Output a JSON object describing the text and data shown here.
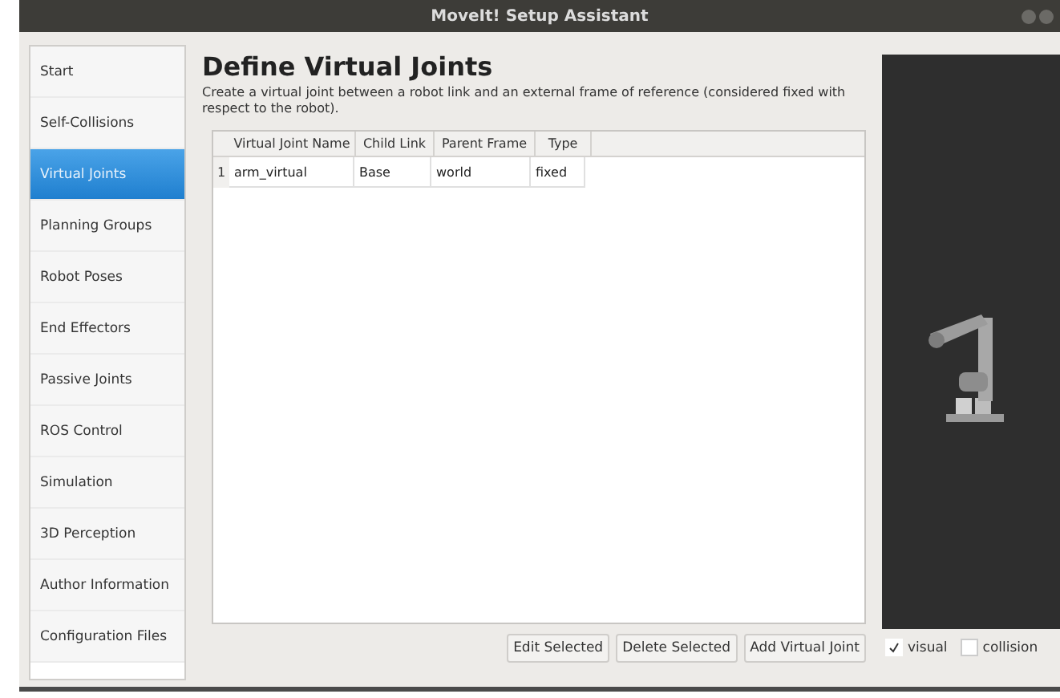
{
  "window": {
    "title": "MoveIt! Setup Assistant"
  },
  "sidebar": {
    "items": [
      {
        "label": "Start",
        "selected": false
      },
      {
        "label": "Self-Collisions",
        "selected": false
      },
      {
        "label": "Virtual Joints",
        "selected": true
      },
      {
        "label": "Planning Groups",
        "selected": false
      },
      {
        "label": "Robot Poses",
        "selected": false
      },
      {
        "label": "End Effectors",
        "selected": false
      },
      {
        "label": "Passive Joints",
        "selected": false
      },
      {
        "label": "ROS Control",
        "selected": false
      },
      {
        "label": "Simulation",
        "selected": false
      },
      {
        "label": "3D Perception",
        "selected": false
      },
      {
        "label": "Author Information",
        "selected": false
      },
      {
        "label": "Configuration Files",
        "selected": false
      }
    ]
  },
  "page": {
    "heading": "Define Virtual Joints",
    "description": "Create a virtual joint between a robot link and an external frame of reference (considered fixed with respect to the robot)."
  },
  "table": {
    "columns": [
      "Virtual Joint Name",
      "Child Link",
      "Parent Frame",
      "Type"
    ],
    "rows": [
      {
        "number": "1",
        "cells": [
          "arm_virtual",
          "Base",
          "world",
          "fixed"
        ]
      }
    ]
  },
  "buttons": [
    "Edit Selected",
    "Delete Selected",
    "Add Virtual Joint"
  ],
  "viewer": {
    "options": [
      {
        "label": "visual",
        "checked": true
      },
      {
        "label": "collision",
        "checked": false
      }
    ]
  }
}
